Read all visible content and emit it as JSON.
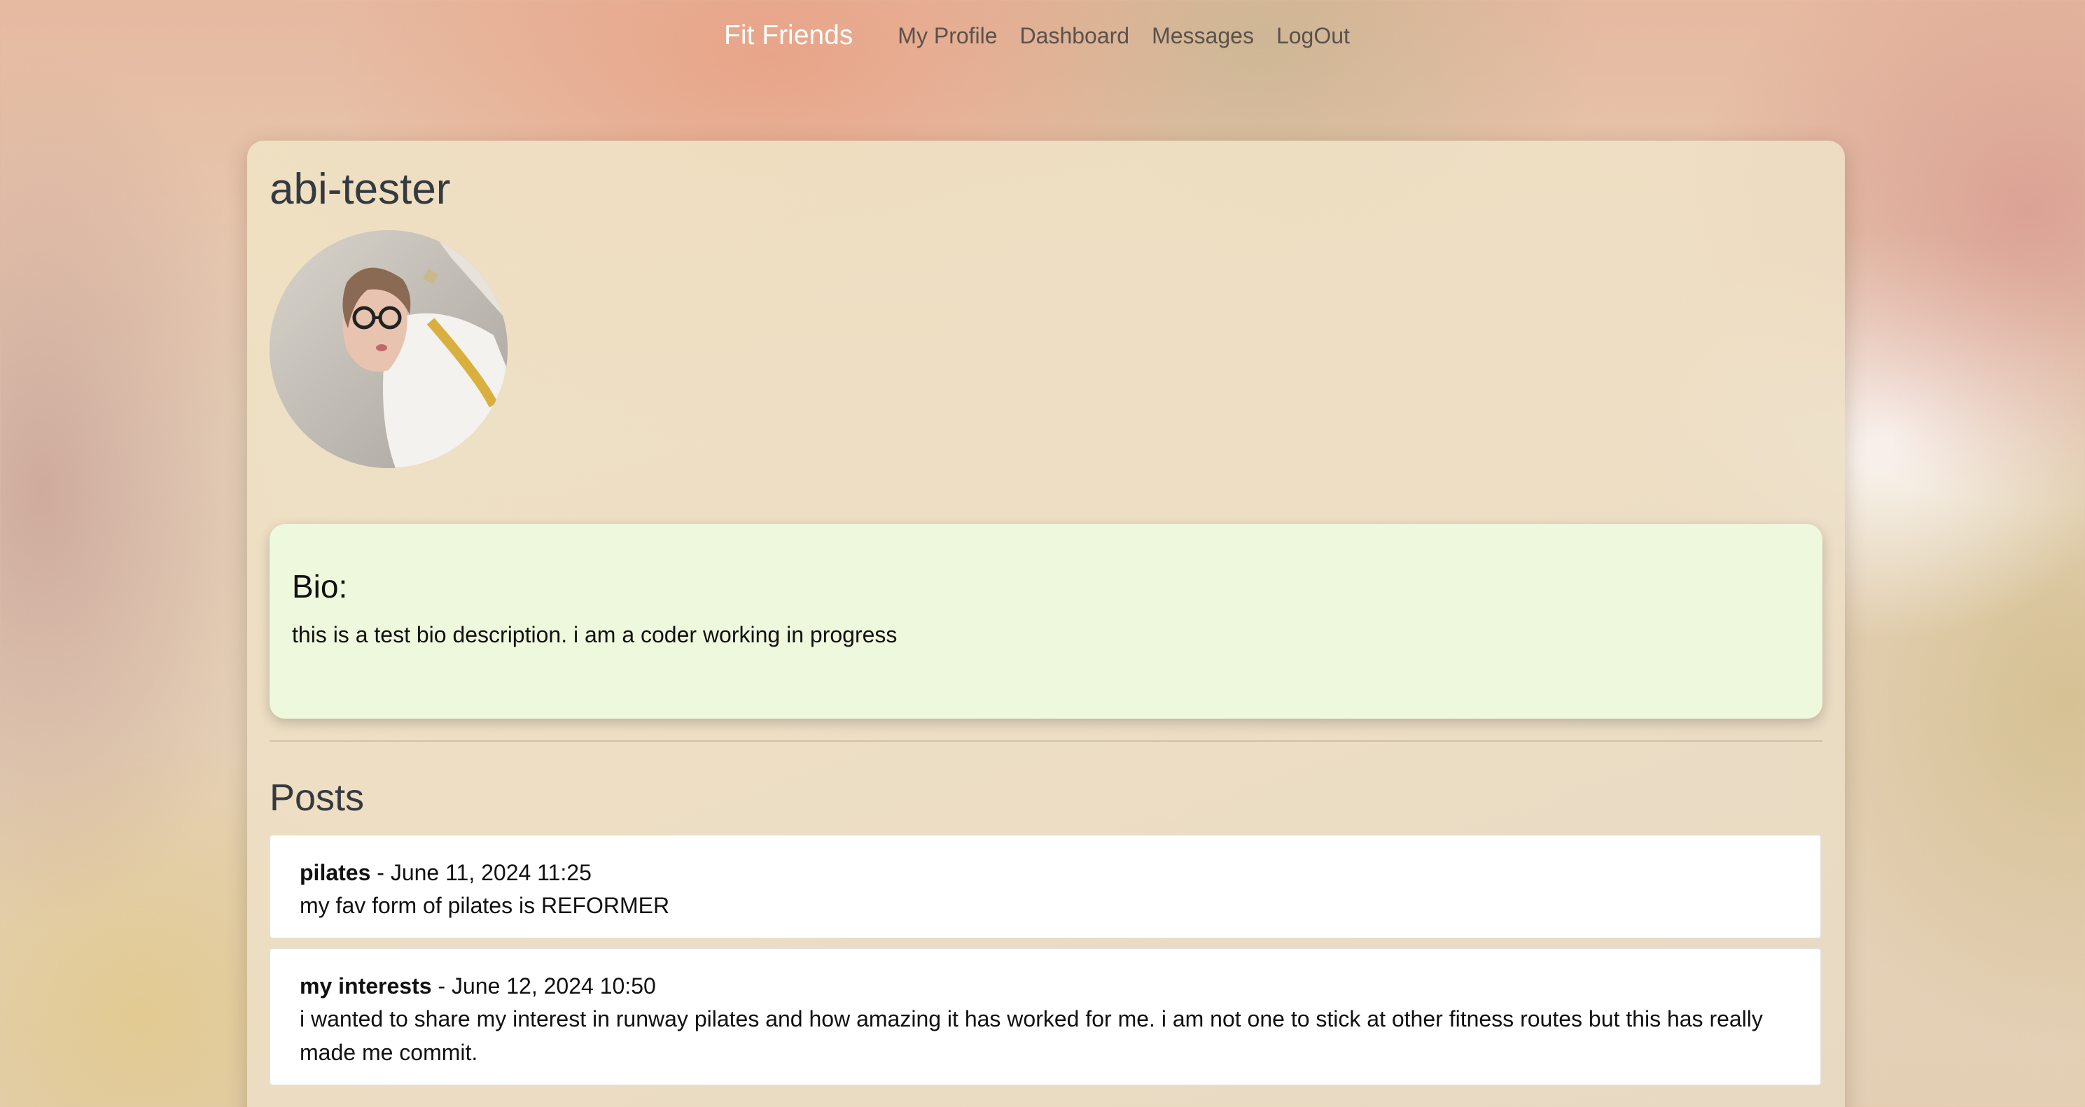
{
  "nav": {
    "brand": "Fit Friends",
    "links": [
      "My Profile",
      "Dashboard",
      "Messages",
      "LogOut"
    ]
  },
  "profile": {
    "username": "abi-tester",
    "avatar_alt": "profile photo"
  },
  "bio": {
    "heading": "Bio:",
    "text": "this is a test bio description. i am a coder working in progress"
  },
  "posts": {
    "heading": "Posts",
    "items": [
      {
        "title": "pilates",
        "separator": " - ",
        "date": "June 11, 2024 11:25",
        "body": "my fav form of pilates is REFORMER"
      },
      {
        "title": "my interests",
        "separator": " - ",
        "date": "June 12, 2024 10:50",
        "body": "i wanted to share my interest in runway pilates and how amazing it has worked for me. i am not one to stick at other fitness routes but this has really made me commit."
      }
    ]
  }
}
